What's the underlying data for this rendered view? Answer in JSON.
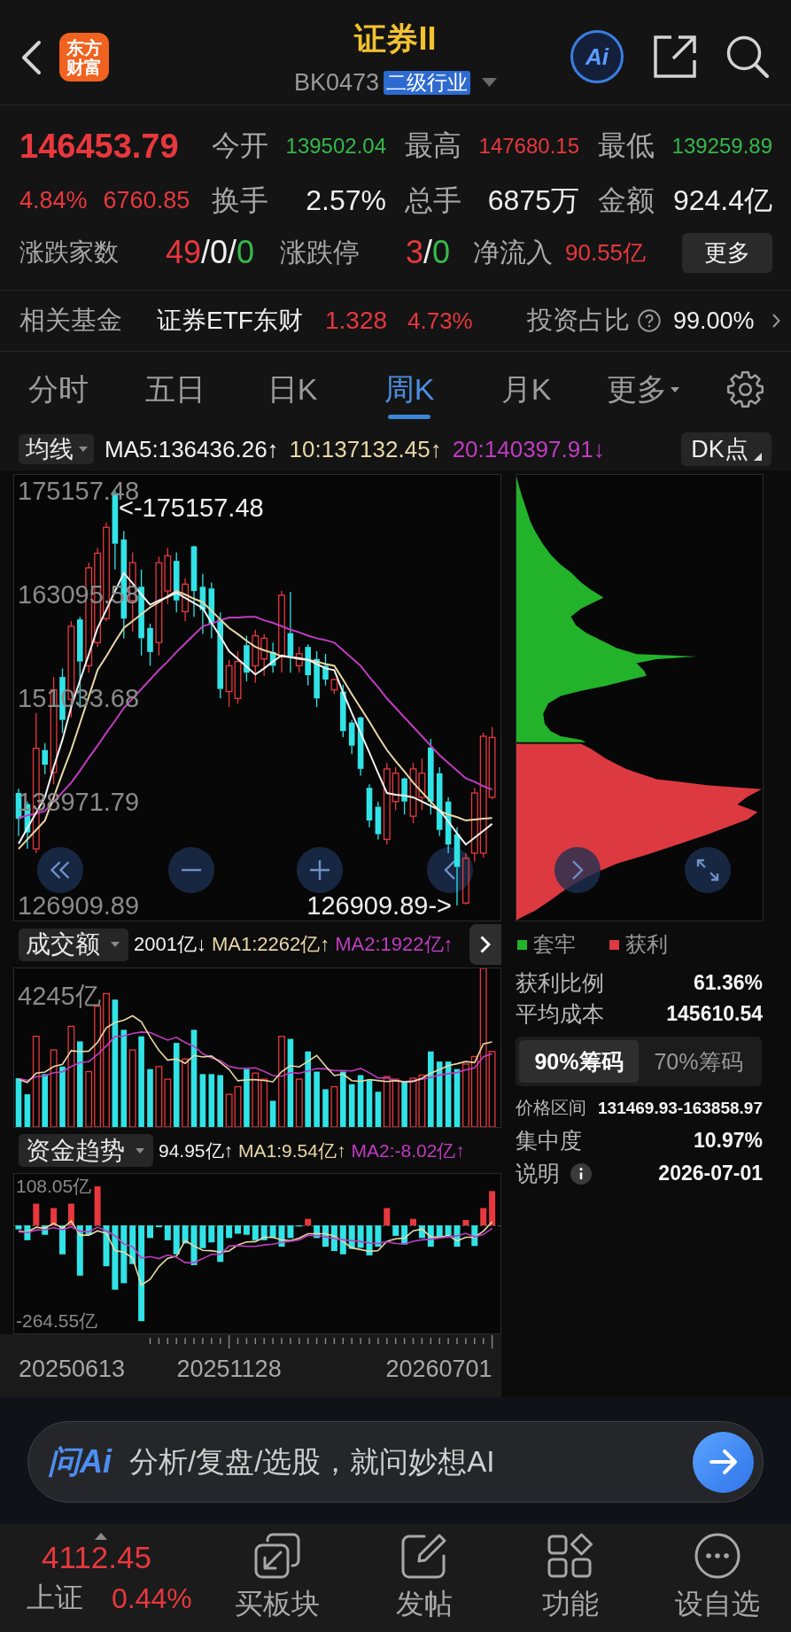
{
  "header": {
    "logo": "东方财富",
    "title": "证券II",
    "code": "BK0473",
    "badge": "二级行业",
    "ai_button": "Ai"
  },
  "quote": {
    "price": "146453.79",
    "change_pct": "4.84%",
    "change": "6760.85",
    "color": "#e8383d",
    "stats": [
      {
        "label": "今开",
        "value": "139502.04",
        "color": "#36b84a"
      },
      {
        "label": "最高",
        "value": "147680.15",
        "color": "#e8383d"
      },
      {
        "label": "最低",
        "value": "139259.89",
        "color": "#36b84a"
      },
      {
        "label": "换手",
        "value": "2.57%"
      },
      {
        "label": "总手",
        "value": "6875万"
      },
      {
        "label": "金额",
        "value": "924.4亿"
      }
    ],
    "breadth": {
      "label": "涨跌家数",
      "parts": [
        {
          "text": "49",
          "color": "#e8383d"
        },
        {
          "text": "/0/"
        },
        {
          "text": "0",
          "color": "#36b84a"
        }
      ]
    },
    "limits": {
      "label": "涨跌停",
      "parts": [
        {
          "text": "3",
          "color": "#e8383d"
        },
        {
          "text": "/"
        },
        {
          "text": "0",
          "color": "#36b84a"
        }
      ]
    },
    "net_inflow": {
      "label": "净流入",
      "value": "90.55亿",
      "color": "#e8383d"
    },
    "more_button": "更多"
  },
  "related_fund": {
    "label": "相关基金",
    "name": "证券ETF东财",
    "price": "1.328",
    "change": "4.73%",
    "color": "#e8383d",
    "ratio_label": "投资占比",
    "ratio": "99.00%"
  },
  "tabs": [
    {
      "label": "分时",
      "selected": false,
      "has_menu": false
    },
    {
      "label": "五日",
      "selected": false,
      "has_menu": false
    },
    {
      "label": "日K",
      "selected": false,
      "has_menu": false
    },
    {
      "label": "周K",
      "selected": true,
      "has_menu": false
    },
    {
      "label": "月K",
      "selected": false,
      "has_menu": false
    },
    {
      "label": "更多",
      "selected": false,
      "has_menu": true
    }
  ],
  "ma_legend": {
    "selector": "均线",
    "values": [
      {
        "text": "MA5:136436.26↑",
        "color": "#f2f2f2"
      },
      {
        "text": "10:137132.45↑",
        "color": "#e9d8a6"
      },
      {
        "text": "20:140397.91↓",
        "color": "#c03cc0"
      }
    ],
    "dk_button": "DK点"
  },
  "kline": {
    "high_marker": "<-175157.48",
    "low_marker": "126909.89->",
    "chart_data": {
      "type": "candlestick",
      "ohlc": [
        [
          140000,
          140500,
          135000,
          137000
        ],
        [
          138700,
          139000,
          133500,
          135400
        ],
        [
          133500,
          149300,
          133000,
          145200
        ],
        [
          145000,
          145800,
          142200,
          143300
        ],
        [
          142400,
          153500,
          141000,
          152000
        ],
        [
          153500,
          154500,
          147000,
          148500
        ],
        [
          150900,
          160000,
          148800,
          159400
        ],
        [
          160200,
          160500,
          149900,
          155300
        ],
        [
          154800,
          166800,
          154000,
          166200
        ],
        [
          157500,
          168500,
          157000,
          167900
        ],
        [
          160300,
          171500,
          160000,
          170900
        ],
        [
          174900,
          175157.48,
          166000,
          169000
        ],
        [
          169500,
          170500,
          158000,
          160300
        ],
        [
          162400,
          168000,
          158800,
          166800
        ],
        [
          164000,
          166000,
          156000,
          158000
        ],
        [
          159200,
          159700,
          154800,
          156400
        ],
        [
          157500,
          167500,
          156000,
          166800
        ],
        [
          163500,
          168500,
          162000,
          167600
        ],
        [
          167000,
          168000,
          161000,
          162400
        ],
        [
          161100,
          165000,
          160000,
          164300
        ],
        [
          168700,
          168800,
          160500,
          163500
        ],
        [
          164000,
          165500,
          158500,
          161300
        ],
        [
          163800,
          164500,
          158000,
          159700
        ],
        [
          160200,
          161000,
          151000,
          152100
        ],
        [
          151800,
          155500,
          150000,
          154800
        ],
        [
          151000,
          156500,
          150400,
          155300
        ],
        [
          157200,
          158300,
          153000,
          154000
        ],
        [
          154800,
          159000,
          152800,
          158300
        ],
        [
          155600,
          158500,
          153600,
          158000
        ],
        [
          156400,
          157500,
          154000,
          154800
        ],
        [
          155900,
          163500,
          154000,
          163000
        ],
        [
          158600,
          163400,
          154000,
          155900
        ],
        [
          154800,
          157000,
          154000,
          156200
        ],
        [
          157000,
          157300,
          152500,
          153700
        ],
        [
          155600,
          156500,
          150000,
          151000
        ],
        [
          154800,
          156200,
          152500,
          153200
        ],
        [
          152000,
          153300,
          151500,
          153200
        ],
        [
          151800,
          152600,
          146500,
          147200
        ],
        [
          148200,
          148500,
          144500,
          145500
        ],
        [
          148800,
          148900,
          142000,
          142800
        ],
        [
          140600,
          141000,
          136000,
          136800
        ],
        [
          138400,
          139000,
          134600,
          135200
        ],
        [
          134600,
          143500,
          134000,
          142800
        ],
        [
          139000,
          143000,
          138000,
          142300
        ],
        [
          141700,
          141800,
          137500,
          139000
        ],
        [
          137300,
          143500,
          136500,
          142800
        ],
        [
          139500,
          144000,
          138000,
          142300
        ],
        [
          145300,
          146300,
          137500,
          139000
        ],
        [
          142300,
          143000,
          135000,
          135700
        ],
        [
          139000,
          139500,
          133000,
          134000
        ],
        [
          135200,
          136000,
          126909.89,
          131400
        ],
        [
          127200,
          133000,
          127000,
          132400
        ],
        [
          133000,
          140600,
          132000,
          140000
        ],
        [
          133000,
          147000,
          132500,
          146600
        ],
        [
          139502.04,
          147680.15,
          139259.89,
          146453.79
        ]
      ],
      "series": [
        {
          "type": "line",
          "color": "#c03cc0",
          "values": [
            137100,
            137400,
            137600,
            137900,
            139000,
            140100,
            141200,
            142600,
            144100,
            145500,
            147000,
            148400,
            149900,
            151000,
            152100,
            153200,
            154300,
            155300,
            156400,
            157400,
            158400,
            159400,
            159700,
            160100,
            160400,
            160400,
            160500,
            160500,
            160100,
            159800,
            159400,
            159000,
            158700,
            158300,
            158000,
            157800,
            157500,
            156600,
            155700,
            154800,
            153500,
            152300,
            151000,
            149900,
            148800,
            147700,
            146600,
            145500,
            144400,
            143500,
            142600,
            141700,
            141300,
            140800,
            140400
          ]
        },
        {
          "type": "line",
          "color": "#e9d8a6",
          "values": [
            133500,
            134600,
            135700,
            136800,
            139500,
            142300,
            145000,
            148100,
            151200,
            154300,
            155900,
            157600,
            159200,
            160000,
            160800,
            161600,
            162200,
            162900,
            163500,
            163100,
            162600,
            162200,
            161200,
            160200,
            159200,
            158500,
            157700,
            157000,
            156600,
            156300,
            155900,
            155800,
            155600,
            155500,
            155300,
            155000,
            154800,
            153200,
            151500,
            149900,
            148300,
            146600,
            145000,
            143700,
            142500,
            141200,
            140100,
            139000,
            137900,
            137500,
            137200,
            136800,
            136900,
            137000,
            137100
          ]
        },
        {
          "type": "line",
          "color": "#f2f2f2",
          "values": [
            134100,
            135900,
            137700,
            139500,
            143000,
            146200,
            150000,
            153100,
            156100,
            159200,
            161300,
            163500,
            165600,
            164400,
            163100,
            161900,
            162400,
            162800,
            163300,
            162700,
            162100,
            161500,
            159800,
            158200,
            156500,
            155600,
            154700,
            153800,
            154500,
            155300,
            156000,
            155800,
            155700,
            155500,
            155000,
            154500,
            154300,
            151700,
            149300,
            147000,
            144700,
            142300,
            140000,
            139800,
            139700,
            139500,
            139000,
            138500,
            138000,
            136700,
            135300,
            134000,
            134800,
            135600,
            136400
          ]
        }
      ],
      "ylim": [
        125157,
        177013
      ],
      "yticks": [
        175157.48,
        163095.58,
        151033.68,
        138971.79,
        126909.89
      ]
    }
  },
  "volume": {
    "selector": "成交额",
    "values": [
      {
        "text": "2001亿↓",
        "color": "#f2f2f2"
      },
      {
        "text": "MA1:2262亿↑",
        "color": "#e9d8a6"
      },
      {
        "text": "MA2:1922亿↑",
        "color": "#c03cc0"
      }
    ],
    "max_label": "4245亿"
  },
  "fund_flow": {
    "selector": "资金趋势",
    "values": [
      {
        "text": "94.95亿↑",
        "color": "#f2f2f2"
      },
      {
        "text": "MA1:9.54亿↑",
        "color": "#e9d8a6"
      },
      {
        "text": "MA2:-8.02亿↑",
        "color": "#c03cc0"
      }
    ],
    "chart_data": {
      "type": "bar",
      "series": [
        {
          "values": [
            -11,
            -41,
            60,
            -26,
            48,
            -80,
            60,
            -139,
            -26,
            108,
            -113,
            -178,
            -160,
            -107,
            -265,
            -35,
            -5,
            -41,
            -80,
            -50,
            -110,
            -63,
            -47,
            -101,
            -35,
            -23,
            -26,
            -41,
            -41,
            -35,
            -59,
            -35,
            -3,
            18,
            -35,
            -59,
            -71,
            -80,
            -65,
            -62,
            -83,
            -59,
            48,
            -29,
            -53,
            18,
            -35,
            -59,
            -35,
            -29,
            -59,
            15,
            -57,
            48,
            95
          ],
          "colors": [
            "#30e3e6",
            "#30e3e6",
            "#e8383d",
            "#30e3e6",
            "#e8383d",
            "#30e3e6",
            "#e8383d",
            "#30e3e6",
            "#30e3e6",
            "#e8383d",
            "#30e3e6",
            "#30e3e6",
            "#30e3e6",
            "#30e3e6",
            "#30e3e6",
            "#30e3e6",
            "#30e3e6",
            "#30e3e6",
            "#30e3e6",
            "#30e3e6",
            "#30e3e6",
            "#30e3e6",
            "#30e3e6",
            "#30e3e6",
            "#30e3e6",
            "#30e3e6",
            "#30e3e6",
            "#30e3e6",
            "#30e3e6",
            "#30e3e6",
            "#30e3e6",
            "#30e3e6",
            "#30e3e6",
            "#e8383d",
            "#30e3e6",
            "#30e3e6",
            "#30e3e6",
            "#30e3e6",
            "#30e3e6",
            "#30e3e6",
            "#30e3e6",
            "#30e3e6",
            "#e8383d",
            "#30e3e6",
            "#30e3e6",
            "#e8383d",
            "#30e3e6",
            "#30e3e6",
            "#30e3e6",
            "#30e3e6",
            "#30e3e6",
            "#e8383d",
            "#30e3e6",
            "#e8383d",
            "#e8383d"
          ]
        },
        {
          "type": "line",
          "color": "#e9d8a6",
          "values": [
            -15,
            -19,
            -5,
            -8,
            6,
            -8,
            12,
            -27,
            -27,
            -15,
            -22,
            -70,
            -74,
            -90,
            -165,
            -149,
            -114,
            -91,
            -85,
            -42,
            -57,
            -69,
            -70,
            -74,
            -71,
            -54,
            -46,
            -45,
            -33,
            -33,
            -40,
            -42,
            -35,
            -23,
            -23,
            -23,
            -30,
            -45,
            -62,
            -67,
            -72,
            -70,
            -44,
            -37,
            -35,
            -15,
            -10,
            -32,
            -33,
            -28,
            -43,
            -33,
            -33,
            -16,
            10
          ]
        },
        {
          "type": "line",
          "color": "#c03cc0",
          "values": [
            -18,
            -20,
            -13,
            -12,
            -6,
            -12,
            -4,
            -16,
            -18,
            -5,
            -15,
            -29,
            -51,
            -59,
            -90,
            -86,
            -92,
            -82,
            -88,
            -103,
            -103,
            -92,
            -80,
            -80,
            -57,
            -56,
            -58,
            -58,
            -54,
            -52,
            -47,
            -44,
            -40,
            -28,
            -28,
            -32,
            -36,
            -40,
            -42,
            -45,
            -48,
            -50,
            -45,
            -50,
            -51,
            -44,
            -40,
            -38,
            -35,
            -32,
            -29,
            -22,
            -32,
            -25,
            -8
          ]
        }
      ],
      "ylim": [
        -298.9,
        142.4
      ],
      "yticks": [
        {
          "value": 108.05,
          "label": "108.05亿"
        },
        {
          "value": -264.55,
          "label": "-264.55亿"
        }
      ]
    }
  },
  "date_axis": {
    "labels": [
      "20250613",
      "20251128",
      "20260701"
    ]
  },
  "chips": {
    "legend": [
      {
        "label": "套牢",
        "color": "#22b32a"
      },
      {
        "label": "获利",
        "color": "#dc3a40"
      }
    ],
    "stats": [
      {
        "label": "获利比例",
        "value": "61.36%"
      },
      {
        "label": "平均成本",
        "value": "145610.54"
      }
    ],
    "modes": [
      {
        "label": "90%筹码",
        "selected": true
      },
      {
        "label": "70%筹码",
        "selected": false
      }
    ],
    "details": [
      {
        "label": "价格区间",
        "value": "131469.93-163858.97",
        "info": false
      },
      {
        "label": "集中度",
        "value": "10.97%",
        "info": false
      },
      {
        "label": "说明",
        "value": "2026-07-01",
        "info": true
      }
    ]
  },
  "ai_bar": {
    "logo": "问Ai",
    "placeholder": "分析/复盘/选股，就问妙想AI"
  },
  "bottom_nav": {
    "index": {
      "value": "4112.45",
      "name": "上证",
      "change": "0.44%",
      "color": "#e8383d"
    },
    "items": [
      {
        "label": "买板块",
        "kind": "trade"
      },
      {
        "label": "发帖",
        "kind": "post"
      },
      {
        "label": "功能",
        "kind": "tools"
      },
      {
        "label": "设自选",
        "kind": "watch"
      }
    ]
  }
}
